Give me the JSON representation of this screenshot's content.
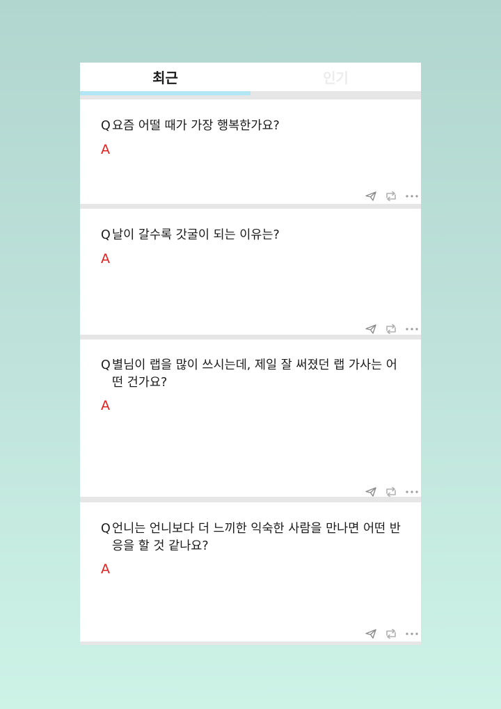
{
  "tabs": [
    {
      "label": "최근",
      "active": true
    },
    {
      "label": "인기",
      "active": false
    }
  ],
  "cards": [
    {
      "q_mark": "Q",
      "question": "요즘 어떨 때가 가장 행복한가요?",
      "a_mark": "A",
      "answer": ""
    },
    {
      "q_mark": "Q",
      "question": "날이 갈수록 갓굴이 되는 이유는?",
      "a_mark": "A",
      "answer": ""
    },
    {
      "q_mark": "Q",
      "question": "별님이 랩을 많이 쓰시는데, 제일 잘 써졌던 랩 가사는 어떤 건가요?",
      "a_mark": "A",
      "answer": ""
    },
    {
      "q_mark": "Q",
      "question": "언니는 언니보다 더 느끼한 익숙한 사람을 만나면 어떤 반응을 할 것 같나요?",
      "a_mark": "A",
      "answer": ""
    }
  ],
  "icons": {
    "send": "paper-plane-icon",
    "share": "repost-icon",
    "more": "more-dots-icon"
  },
  "colors": {
    "accent_tab": "#b2e6f5",
    "answer_mark": "#e02020",
    "icon": "#8a8a8a"
  }
}
